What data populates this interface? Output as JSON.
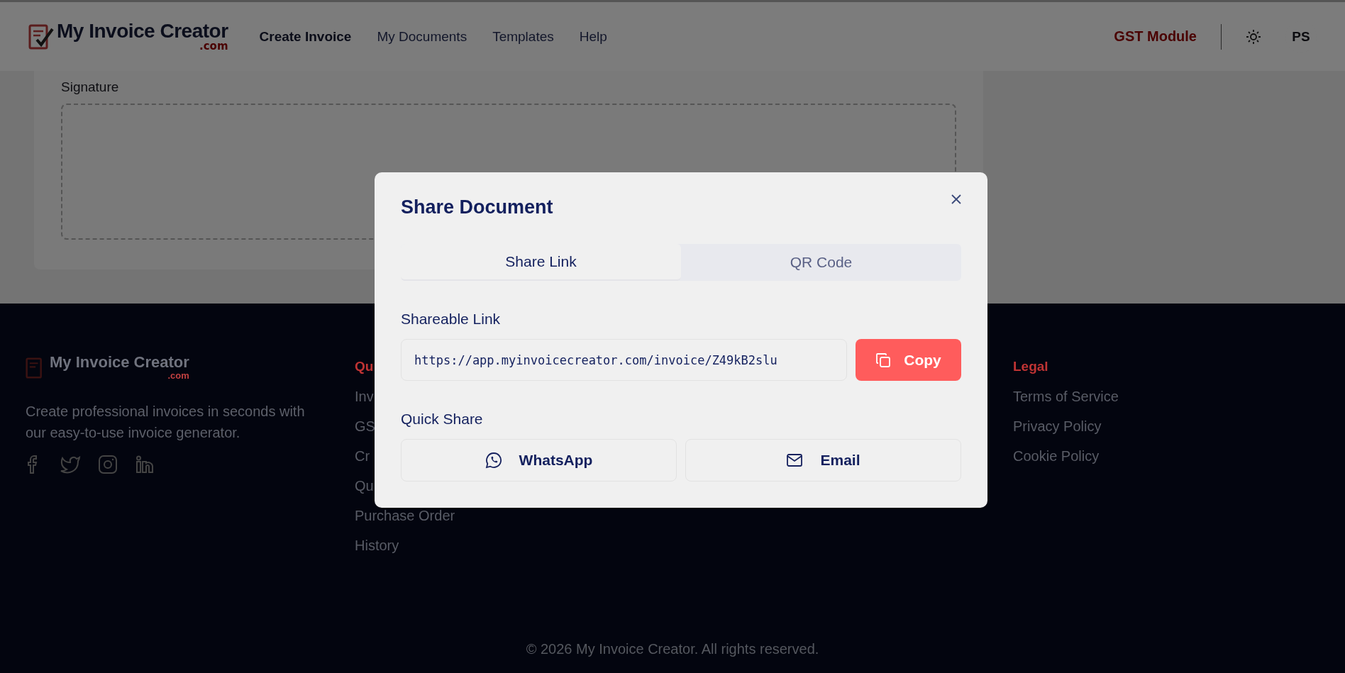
{
  "header": {
    "logo": {
      "text": "My Invoice Creator",
      "sub": ".com"
    },
    "nav": [
      {
        "label": "Create Invoice",
        "selected": true
      },
      {
        "label": "My Documents",
        "selected": false
      },
      {
        "label": "Templates",
        "selected": false
      },
      {
        "label": "Help",
        "selected": false
      }
    ],
    "gst_link": "GST Module",
    "user_initials": "PS"
  },
  "page": {
    "signature_label": "Signature"
  },
  "footer": {
    "logo": {
      "text": "My Invoice Creator",
      "sub": ".com"
    },
    "description": "Create professional invoices in seconds with our easy-to-use invoice generator.",
    "columns": [
      {
        "title": "Qu",
        "links": [
          "Inv",
          "GS",
          "Cr",
          "Qu",
          "Purchase Order",
          "History"
        ]
      },
      {
        "title": "Legal",
        "links": [
          "Terms of Service",
          "Privacy Policy",
          "Cookie Policy"
        ]
      }
    ],
    "copyright": "© 2026 My Invoice Creator. All rights reserved."
  },
  "modal": {
    "title": "Share Document",
    "tabs": [
      {
        "label": "Share Link",
        "selected": true
      },
      {
        "label": "QR Code",
        "selected": false
      }
    ],
    "link_label": "Shareable Link",
    "link_value": "https://app.myinvoicecreator.com/invoice/Z49kB2slu",
    "copy_button": "Copy",
    "quick_share_label": "Quick Share",
    "share_buttons": [
      {
        "label": "WhatsApp",
        "kind": "whatsapp"
      },
      {
        "label": "Email",
        "kind": "email"
      }
    ]
  }
}
